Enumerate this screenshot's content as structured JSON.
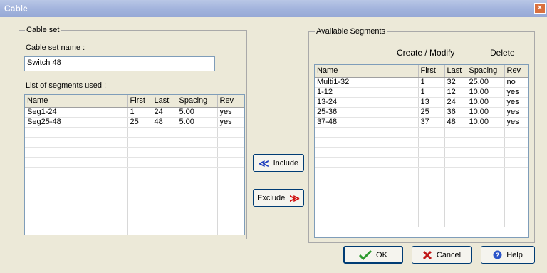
{
  "window": {
    "title": "Cable",
    "close_glyph": "×"
  },
  "cable_set": {
    "group_label": "Cable set",
    "name_label": "Cable set name :",
    "name_value": "Switch 48",
    "list_label": "List of segments used :",
    "columns": [
      "Name",
      "First",
      "Last",
      "Spacing",
      "Rev"
    ],
    "rows": [
      [
        "Seg1-24",
        "1",
        "24",
        "5.00",
        "yes"
      ],
      [
        "Seg25-48",
        "25",
        "48",
        "5.00",
        "yes"
      ],
      [
        "",
        "",
        "",
        "",
        ""
      ],
      [
        "",
        "",
        "",
        "",
        ""
      ],
      [
        "",
        "",
        "",
        "",
        ""
      ],
      [
        "",
        "",
        "",
        "",
        ""
      ],
      [
        "",
        "",
        "",
        "",
        ""
      ],
      [
        "",
        "",
        "",
        "",
        ""
      ],
      [
        "",
        "",
        "",
        "",
        ""
      ],
      [
        "",
        "",
        "",
        "",
        ""
      ],
      [
        "",
        "",
        "",
        "",
        ""
      ],
      [
        "",
        "",
        "",
        "",
        ""
      ],
      [
        "",
        "",
        "",
        "",
        ""
      ]
    ]
  },
  "available": {
    "group_label": "Available Segments",
    "create_modify_label": "Create / Modify",
    "delete_label": "Delete",
    "columns": [
      "Name",
      "First",
      "Last",
      "Spacing",
      "Rev"
    ],
    "rows": [
      [
        "Multi1-32",
        "1",
        "32",
        "25.00",
        "no"
      ],
      [
        "1-12",
        "1",
        "12",
        "10.00",
        "yes"
      ],
      [
        "13-24",
        "13",
        "24",
        "10.00",
        "yes"
      ],
      [
        "25-36",
        "25",
        "36",
        "10.00",
        "yes"
      ],
      [
        "37-48",
        "37",
        "48",
        "10.00",
        "yes"
      ],
      [
        "",
        "",
        "",
        "",
        ""
      ],
      [
        "",
        "",
        "",
        "",
        ""
      ],
      [
        "",
        "",
        "",
        "",
        ""
      ],
      [
        "",
        "",
        "",
        "",
        ""
      ],
      [
        "",
        "",
        "",
        "",
        ""
      ],
      [
        "",
        "",
        "",
        "",
        ""
      ],
      [
        "",
        "",
        "",
        "",
        ""
      ],
      [
        "",
        "",
        "",
        "",
        ""
      ],
      [
        "",
        "",
        "",
        "",
        ""
      ],
      [
        "",
        "",
        "",
        "",
        ""
      ]
    ]
  },
  "buttons": {
    "include_label": "Include",
    "include_glyph": "≪",
    "exclude_label": "Exclude",
    "exclude_glyph": "≫",
    "ok_label": "OK",
    "cancel_label": "Cancel",
    "help_label": "Help"
  },
  "colors": {
    "include_arrow": "#1f3fbf",
    "exclude_arrow": "#d01010",
    "ok_check": "#2e9a2e",
    "cancel_x": "#c01818",
    "help_icon": "#2a54c8"
  }
}
